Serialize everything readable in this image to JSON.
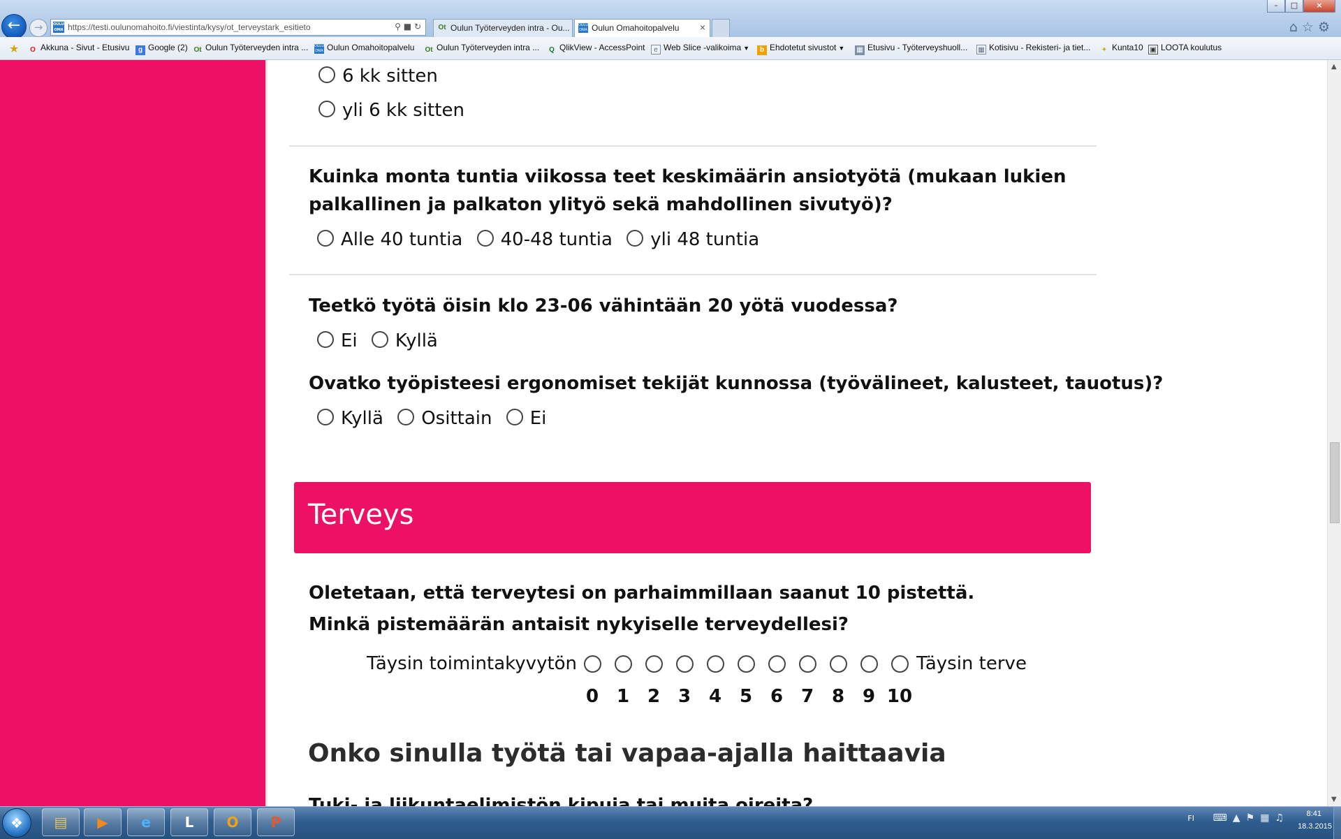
{
  "browser": {
    "url": "https://testi.oulunomahoito.fi/viestinta/kysy/ot_terveystark_esitieto",
    "tabs": [
      {
        "label": "Oulun Työterveyden intra - Ou..."
      },
      {
        "label": "Oulun Omahoitopalvelu"
      }
    ],
    "favorites": [
      {
        "label": "Akkuna - Sivut - Etusivu",
        "icon": "akkuna-icon"
      },
      {
        "label": "Google (2)",
        "icon": "google-icon"
      },
      {
        "label": "Oulun Työterveyden intra ...",
        "icon": "intra-icon"
      },
      {
        "label": "Oulun Omahoitopalvelu",
        "icon": "omahoito-icon"
      },
      {
        "label": "Oulun Työterveyden intra ...",
        "icon": "intra-icon"
      },
      {
        "label": "QlikView - AccessPoint",
        "icon": "qlikview-icon"
      },
      {
        "label": "Web Slice -valikoima",
        "icon": "web-slice-icon"
      },
      {
        "label": "Ehdotetut sivustot",
        "icon": "suggested-sites-icon"
      },
      {
        "label": "Etusivu - Työterveyshuoll...",
        "icon": "page-icon"
      },
      {
        "label": "Kotisivu - Rekisteri- ja tiet...",
        "icon": "page-icon"
      },
      {
        "label": "Kunta10",
        "icon": "kunta10-icon"
      },
      {
        "label": "LOOTA koulutus",
        "icon": "loota-icon"
      }
    ]
  },
  "form": {
    "q_previous": {
      "options": [
        "6 kk sitten",
        "yli 6 kk sitten"
      ]
    },
    "q_hours": {
      "line1": "Kuinka monta tuntia viikossa teet keskimäärin ansiotyötä (mukaan lukien",
      "line2": "palkallinen ja palkaton ylityö sekä mahdollinen sivutyö)?",
      "options": [
        "Alle 40 tuntia",
        "40-48 tuntia",
        "yli 48 tuntia"
      ]
    },
    "q_night": {
      "text": "Teetkö työtä öisin klo 23-06 vähintään 20 yötä vuodessa?",
      "options": [
        "Ei",
        "Kyllä"
      ]
    },
    "q_ergonomics": {
      "text": "Ovatko työpisteesi ergonomiset tekijät kunnossa (työvälineet, kalusteet, tauotus)?",
      "options": [
        "Kyllä",
        "Osittain",
        "Ei"
      ]
    },
    "section_title": "Terveys",
    "q_health": {
      "line1": "Oletetaan, että terveytesi on parhaimmillaan saanut 10 pistettä.",
      "line2": "Minkä pistemäärän antaisit nykyiselle terveydellesi?",
      "scale_min_label": "Täysin toimintakyvytön",
      "scale_max_label": "Täysin terve",
      "scale": [
        "0",
        "1",
        "2",
        "3",
        "4",
        "5",
        "6",
        "7",
        "8",
        "9",
        "10"
      ]
    },
    "subheading": "Onko sinulla työtä tai vapaa-ajalla haittaavia",
    "q_musculo_cut": "Tuki- ja liikuntaelimistön kipuja tai muita oireita?"
  },
  "taskbar": {
    "language": "FI",
    "time": "8:41",
    "date": "18.3.2015"
  }
}
